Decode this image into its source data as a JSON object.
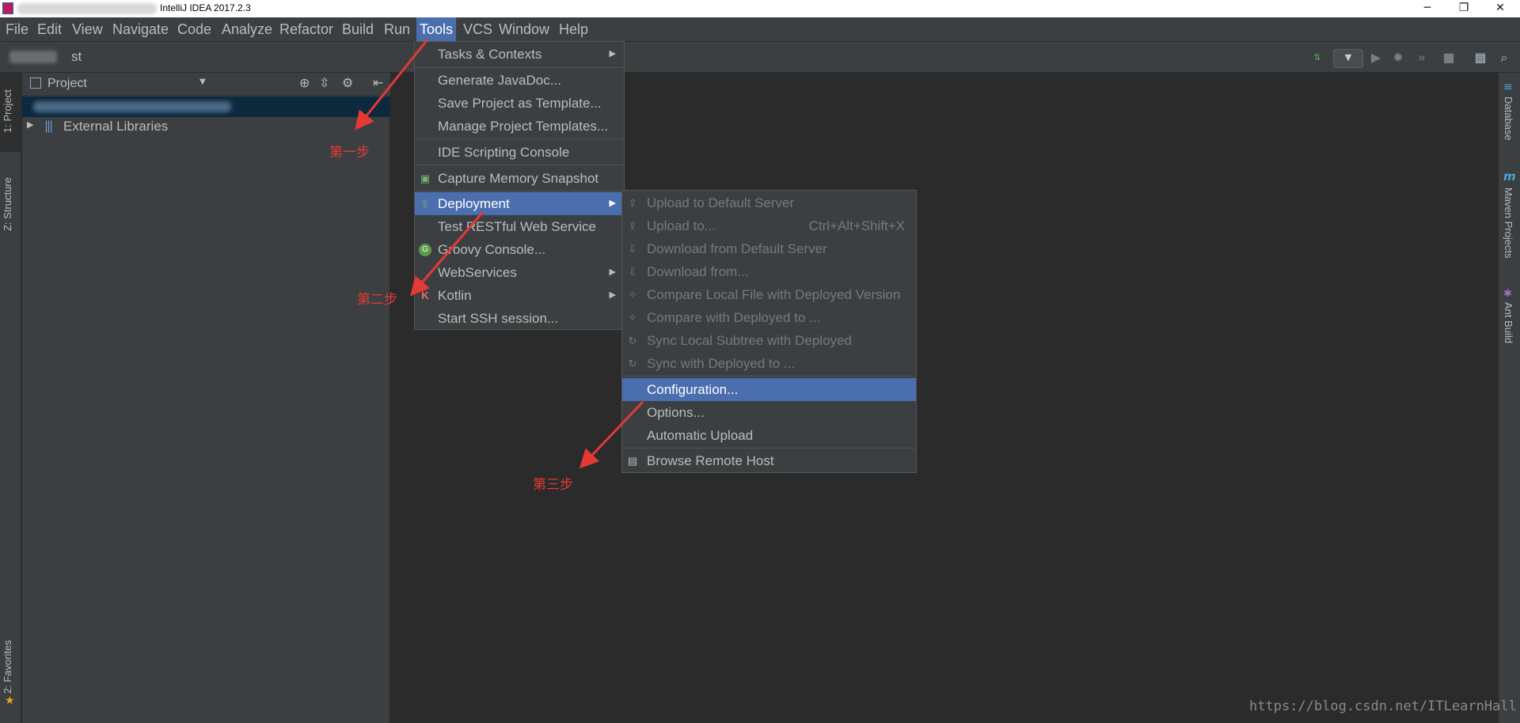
{
  "titlebar": {
    "title": "IntelliJ IDEA 2017.2.3",
    "minimize": "─",
    "maximize": "❐",
    "close": "✕"
  },
  "menubar": [
    "File",
    "Edit",
    "View",
    "Navigate",
    "Code",
    "Analyze",
    "Refactor",
    "Build",
    "Run",
    "Tools",
    "VCS",
    "Window",
    "Help"
  ],
  "navbar": {
    "crumb": "st"
  },
  "left_tabs": {
    "project": "1: Project",
    "structure": "Z: Structure",
    "favorites": "2: Favorites"
  },
  "right_tabs": {
    "database": "Database",
    "maven": "Maven Projects",
    "ant": "Ant Build"
  },
  "project_panel": {
    "title": "Project",
    "external_libraries": "External Libraries"
  },
  "tools_menu": {
    "tasks_contexts": "Tasks & Contexts",
    "generate_javadoc": "Generate JavaDoc...",
    "save_template": "Save Project as Template...",
    "manage_templates": "Manage Project Templates...",
    "ide_scripting": "IDE Scripting Console",
    "capture_memory": "Capture Memory Snapshot",
    "deployment": "Deployment",
    "test_restful": "Test RESTful Web Service",
    "groovy_console": "Groovy Console...",
    "webservices": "WebServices",
    "kotlin": "Kotlin",
    "start_ssh": "Start SSH session..."
  },
  "deployment_menu": {
    "upload_default": "Upload to Default Server",
    "upload_to": "Upload to...",
    "upload_to_shortcut": "Ctrl+Alt+Shift+X",
    "download_default": "Download from Default Server",
    "download_from": "Download from...",
    "compare_local": "Compare Local File with Deployed Version",
    "compare_deployed": "Compare with Deployed to ...",
    "sync_subtree": "Sync Local Subtree with Deployed",
    "sync_deployed": "Sync with Deployed to ...",
    "configuration": "Configuration...",
    "options": "Options...",
    "automatic_upload": "Automatic Upload",
    "browse_remote": "Browse Remote Host"
  },
  "annotations": {
    "step1": "第一步",
    "step2": "第二步",
    "step3": "第三步"
  },
  "watermark": "https://blog.csdn.net/ITLearnHall",
  "colors": {
    "accent": "#4b6eaf",
    "annotation": "#e53935",
    "background": "#2b2b2b",
    "panel": "#3c3f41"
  }
}
